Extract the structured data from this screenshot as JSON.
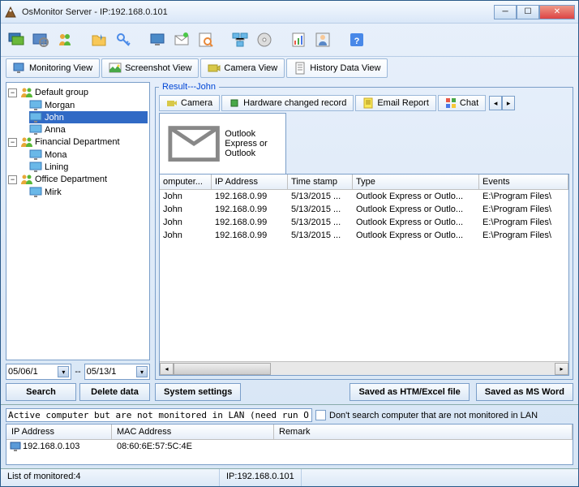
{
  "title": "OsMonitor Server -  IP:192.168.0.101",
  "viewTabs": {
    "monitoring": "Monitoring View",
    "screenshot": "Screenshot View",
    "camera": "Camera View",
    "history": "History Data View"
  },
  "tree": {
    "groups": [
      {
        "name": "Default group",
        "children": [
          "Morgan",
          "John",
          "Anna"
        ],
        "selected": "John"
      },
      {
        "name": "Financial Department",
        "children": [
          "Mona",
          "Lining"
        ]
      },
      {
        "name": "Office Department",
        "children": [
          "Mirk"
        ]
      }
    ]
  },
  "dates": {
    "from": "05/06/1",
    "sep": "--",
    "to": "05/13/1"
  },
  "buttons": {
    "search": "Search",
    "delete": "Delete data",
    "system": "System settings",
    "saveHtm": "Saved as HTM/Excel file",
    "saveWord": "Saved as MS Word"
  },
  "result": {
    "legend": "Result---John",
    "tabs": {
      "camera": "Camera",
      "hardware": "Hardware changed record",
      "email": "Email Report",
      "chat": "Chat"
    },
    "activeTab": "Outlook Express or Outlook",
    "columns": {
      "c1": "omputer...",
      "c2": "IP Address",
      "c3": "Time stamp",
      "c4": "Type",
      "c5": "Events"
    },
    "rows": [
      {
        "name": "John",
        "ip": "192.168.0.99",
        "ts": "5/13/2015 ...",
        "type": "Outlook Express or Outlo...",
        "ev": "E:\\Program Files\\"
      },
      {
        "name": "John",
        "ip": "192.168.0.99",
        "ts": "5/13/2015 ...",
        "type": "Outlook Express or Outlo...",
        "ev": "E:\\Program Files\\"
      },
      {
        "name": "John",
        "ip": "192.168.0.99",
        "ts": "5/13/2015 ...",
        "type": "Outlook Express or Outlo...",
        "ev": "E:\\Program Files\\"
      },
      {
        "name": "John",
        "ip": "192.168.0.99",
        "ts": "5/13/2015 ...",
        "type": "Outlook Express or Outlo...",
        "ev": "E:\\Program Files\\"
      }
    ]
  },
  "lower": {
    "msg": "Active computer but are not monitored in LAN (need run OsMon",
    "chkLabel": "Don't search computer that are not monitored in LAN",
    "cols": {
      "ip": "IP Address",
      "mac": "MAC Address",
      "remark": "Remark"
    },
    "row": {
      "ip": "192.168.0.103",
      "mac": "08:60:6E:57:5C:4E"
    }
  },
  "status": {
    "left": "List of monitored:4",
    "right": "IP:192.168.0.101"
  }
}
